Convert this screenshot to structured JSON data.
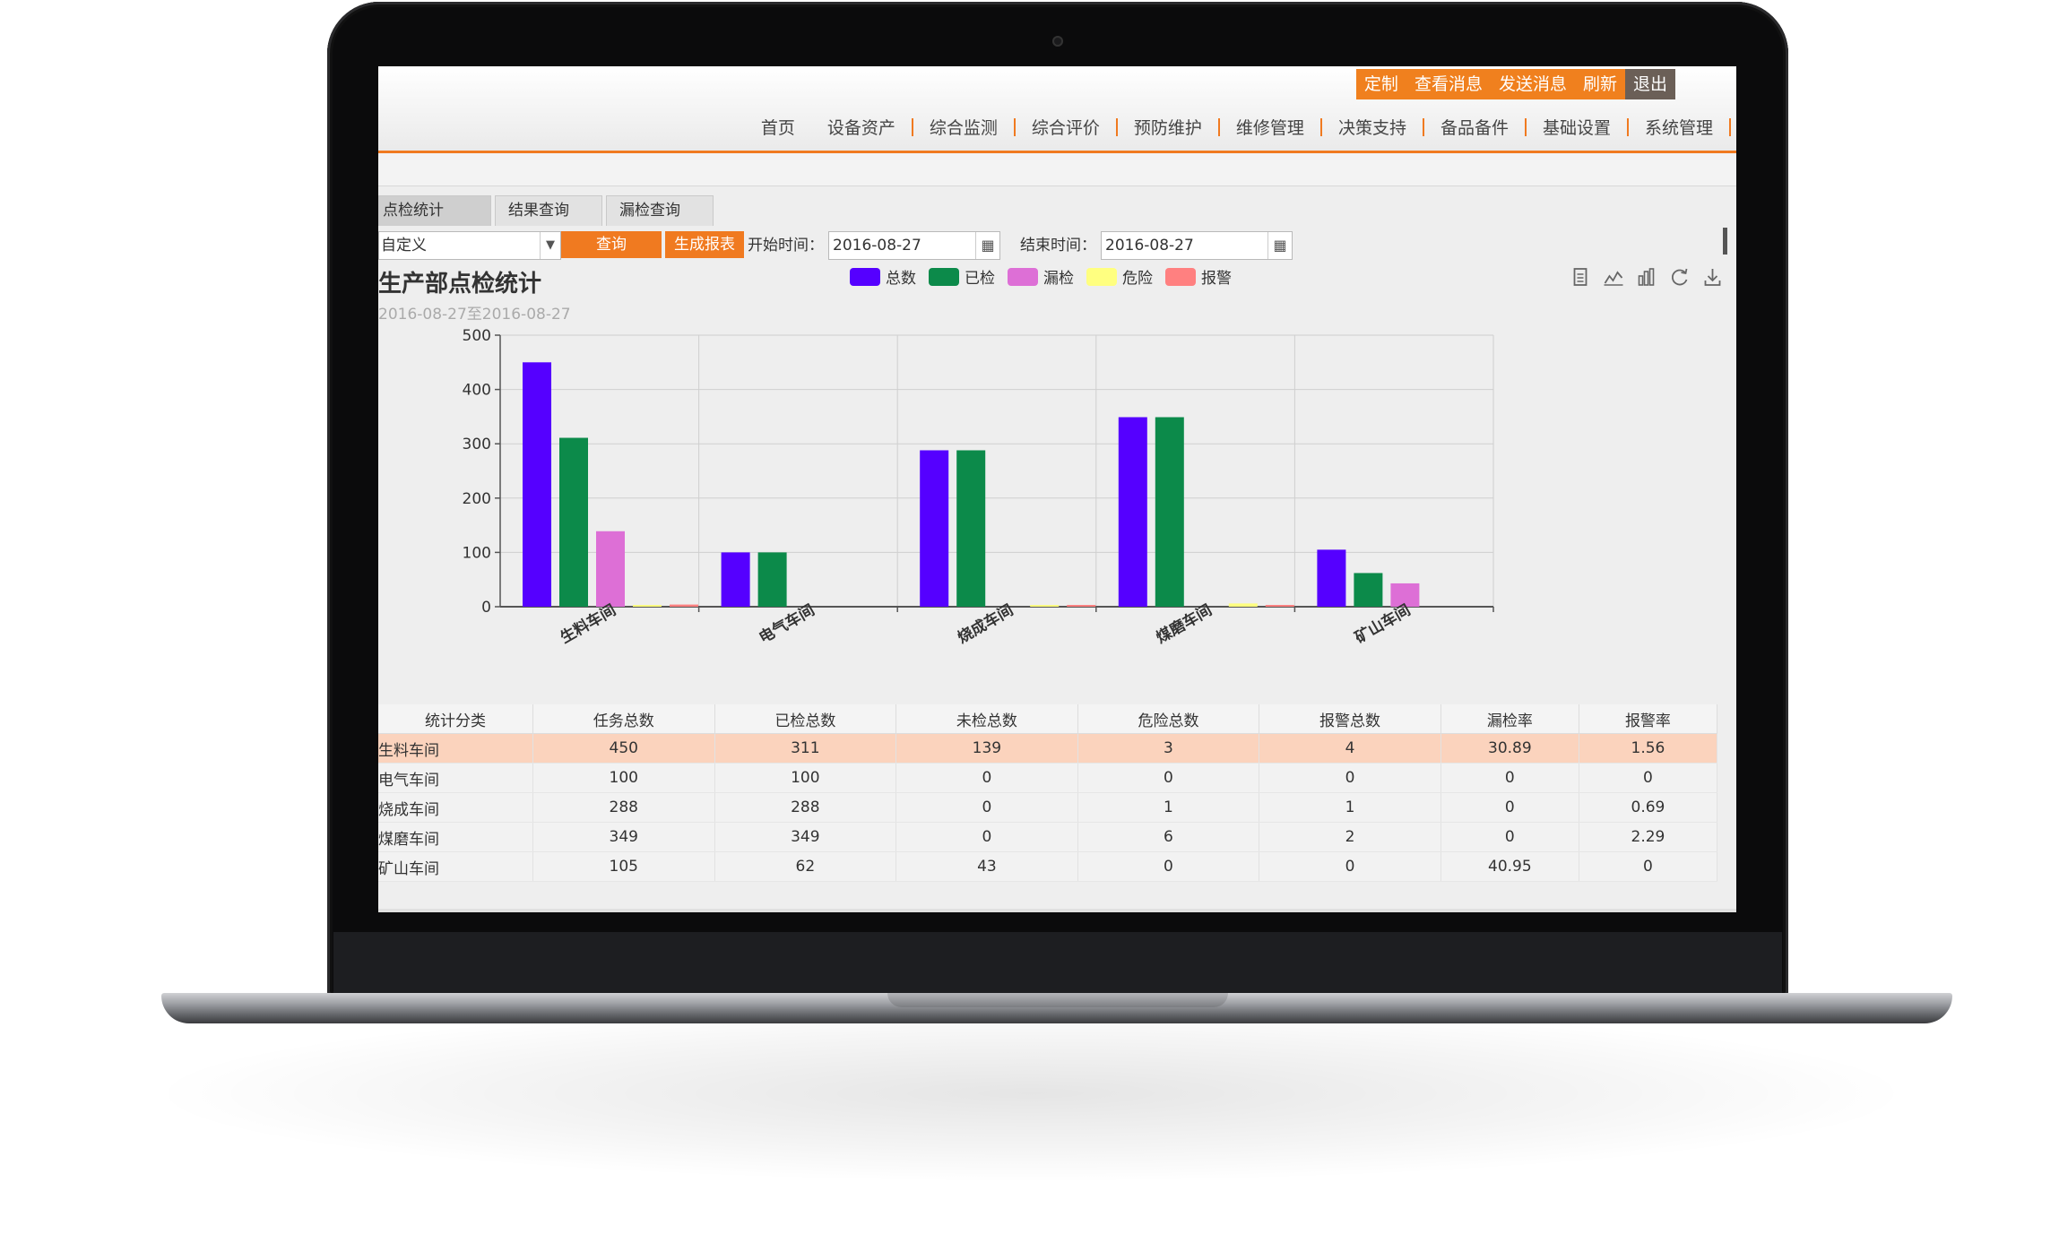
{
  "topbar": {
    "buttons": [
      "定制",
      "查看消息",
      "发送消息",
      "刷新"
    ],
    "exit": "退出"
  },
  "nav": {
    "items": [
      "首页",
      "设备资产",
      "综合监测",
      "综合评价",
      "预防维护",
      "维修管理",
      "决策支持",
      "备品备件",
      "基础设置",
      "系统管理"
    ]
  },
  "tabs": [
    "点检统计",
    "结果查询",
    "漏检查询"
  ],
  "toolbar": {
    "select_value": "自定义",
    "query_button": "查询",
    "report_button": "生成报表",
    "start_label": "开始时间：",
    "start_value": "2016-08-27",
    "end_label": "结束时间：",
    "end_value": "2016-08-27"
  },
  "report": {
    "title": "生产部点检统计",
    "subtitle": "2016-08-27至2016-08-27"
  },
  "toolbox_icons": [
    "data-view-icon",
    "line-chart-icon",
    "bar-chart-icon",
    "refresh-icon",
    "download-icon"
  ],
  "chart_data": {
    "type": "bar",
    "title": "生产部点检统计",
    "subtitle": "2016-08-27至2016-08-27",
    "categories": [
      "生料车间",
      "电气车间",
      "烧成车间",
      "煤磨车间",
      "矿山车间"
    ],
    "ylim": [
      0,
      500
    ],
    "yticks": [
      0,
      100,
      200,
      300,
      400,
      500
    ],
    "legend_position": "top",
    "grid": true,
    "series": [
      {
        "name": "总数",
        "color": "#5500ff",
        "values": [
          450,
          100,
          288,
          349,
          105
        ]
      },
      {
        "name": "已检",
        "color": "#0c8a4a",
        "values": [
          311,
          100,
          288,
          349,
          62
        ]
      },
      {
        "name": "漏检",
        "color": "#dd6fd6",
        "values": [
          139,
          0,
          0,
          0,
          43
        ]
      },
      {
        "name": "危险",
        "color": "#ffff80",
        "values": [
          3,
          0,
          1,
          6,
          0
        ]
      },
      {
        "name": "报警",
        "color": "#ff8080",
        "values": [
          4,
          0,
          1,
          2,
          0
        ]
      }
    ]
  },
  "table": {
    "headers": [
      "统计分类",
      "任务总数",
      "已检总数",
      "未检总数",
      "危险总数",
      "报警总数",
      "漏检率",
      "报警率"
    ],
    "rows": [
      [
        "生料车间",
        "450",
        "311",
        "139",
        "3",
        "4",
        "30.89",
        "1.56"
      ],
      [
        "电气车间",
        "100",
        "100",
        "0",
        "0",
        "0",
        "0",
        "0"
      ],
      [
        "烧成车间",
        "288",
        "288",
        "0",
        "1",
        "1",
        "0",
        "0.69"
      ],
      [
        "煤磨车间",
        "349",
        "349",
        "0",
        "6",
        "2",
        "0",
        "2.29"
      ],
      [
        "矿山车间",
        "105",
        "62",
        "43",
        "0",
        "0",
        "40.95",
        "0"
      ]
    ]
  },
  "colors": {
    "accent": "#f07a20",
    "exit": "#6b5f57",
    "highlight_row": "#fbd3bd"
  }
}
